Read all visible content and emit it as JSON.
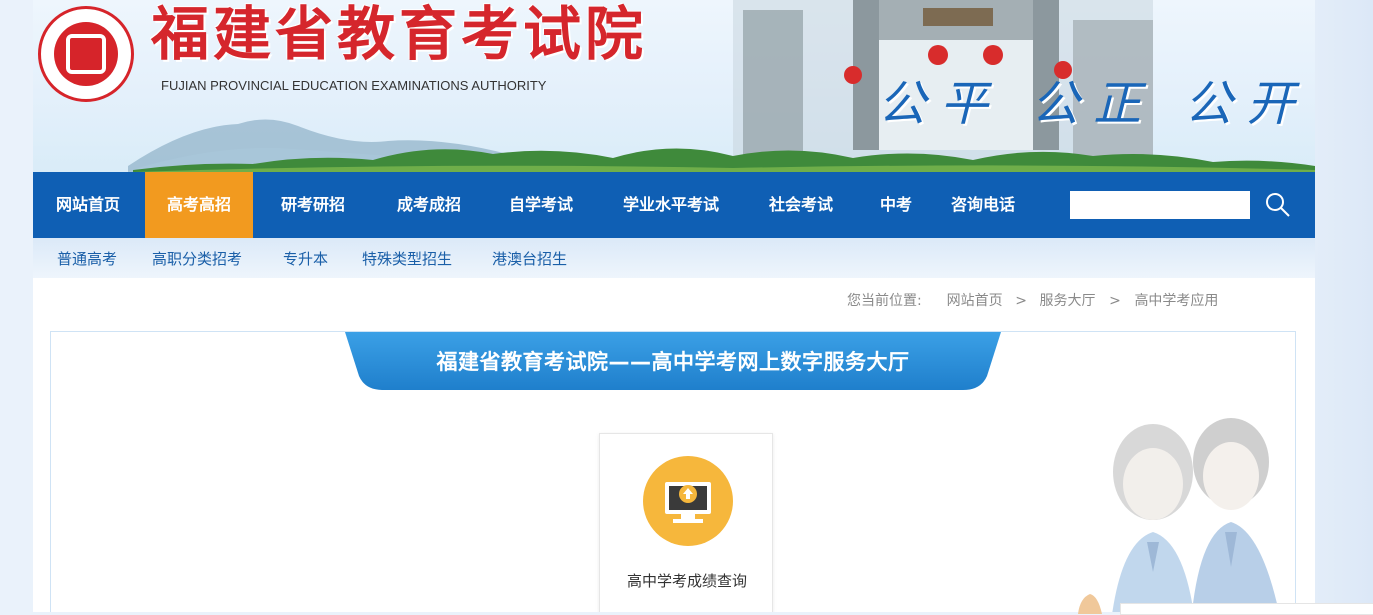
{
  "header": {
    "site_title": "福建省教育考试院",
    "site_subtitle": "FUJIAN PROVINCIAL EDUCATION EXAMINATIONS AUTHORITY",
    "slogan": "公平 公正 公开",
    "logo_icon": "seal-emblem-icon"
  },
  "nav": {
    "items": [
      {
        "label": "网站首页",
        "active": false
      },
      {
        "label": "高考高招",
        "active": true
      },
      {
        "label": "研考研招",
        "active": false
      },
      {
        "label": "成考成招",
        "active": false
      },
      {
        "label": "自学考试",
        "active": false
      },
      {
        "label": "学业水平考试",
        "active": false
      },
      {
        "label": "社会考试",
        "active": false
      },
      {
        "label": "中考",
        "active": false
      },
      {
        "label": "咨询电话",
        "active": false
      }
    ],
    "search_value": "",
    "search_icon": "search-icon"
  },
  "subnav": {
    "items": [
      "普通高考",
      "高职分类招考",
      "专升本",
      "特殊类型招生",
      "港澳台招生"
    ]
  },
  "breadcrumb": {
    "prefix": "您当前位置:",
    "items": [
      "网站首页",
      "服务大厅",
      "高中学考应用"
    ],
    "separator": ">"
  },
  "main": {
    "banner_title": "福建省教育考试院——高中学考网上数字服务大厅",
    "services": [
      {
        "label": "高中学考成绩查询",
        "icon": "monitor-upload-icon"
      }
    ]
  },
  "colors": {
    "nav_bg": "#0f5fb4",
    "nav_active": "#f29a1f",
    "title_red": "#d5262c",
    "ribbon_blue": "#2a8fd8",
    "icon_yellow": "#f6b73c"
  }
}
